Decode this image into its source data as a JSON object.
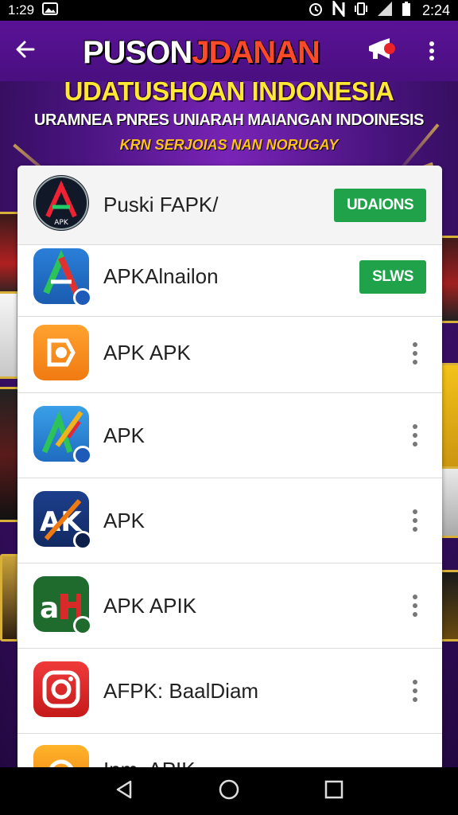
{
  "status_bar": {
    "left_time": "1:29",
    "clock": "2:24",
    "icons": [
      "photo-icon",
      "alarm-icon",
      "nfc-icon",
      "vibrate-icon",
      "signal-icon",
      "battery-icon"
    ]
  },
  "app_bar": {
    "title_main": "PUSON",
    "title_highlight": "JDANAN",
    "icons": [
      "back-arrow-icon",
      "megaphone-icon",
      "more-vert-icon"
    ]
  },
  "banner": {
    "headline": "UDATUSHOAN INDONESIA",
    "subheadline": "URAMNEA PNRES UNIARAH MAIANGAN INDOINESIS",
    "tagline": "KRN SERJOIAS NAN NORUGAY"
  },
  "apps": [
    {
      "name": "Puski FAPK/",
      "action": "UDAIONS",
      "icon": "apk-dark-logo-icon"
    },
    {
      "name": "APKAlnailon",
      "action": "SLWS",
      "icon": "apk-triangle-logo-icon"
    },
    {
      "name": "APK APK",
      "icon": "orange-square-logo-icon"
    },
    {
      "name": "APK",
      "icon": "apk-pen-logo-icon"
    },
    {
      "name": "APK",
      "icon": "apk-x-logo-icon"
    },
    {
      "name": "APK APIK",
      "icon": "green-ah-logo-icon"
    },
    {
      "name": "AFPK: BaalDiam",
      "icon": "red-camera-logo-icon"
    },
    {
      "name": "Ipm. APIK",
      "icon": "orange-partial-logo-icon"
    }
  ],
  "colors": {
    "primary_purple": "#4a0f80",
    "accent_yellow": "#ffe833",
    "action_green": "#1fa24a",
    "title_highlight": "#ff4a2a"
  },
  "nav_bar": {
    "icons": [
      "back-triangle-icon",
      "home-circle-icon",
      "recents-square-icon"
    ]
  }
}
